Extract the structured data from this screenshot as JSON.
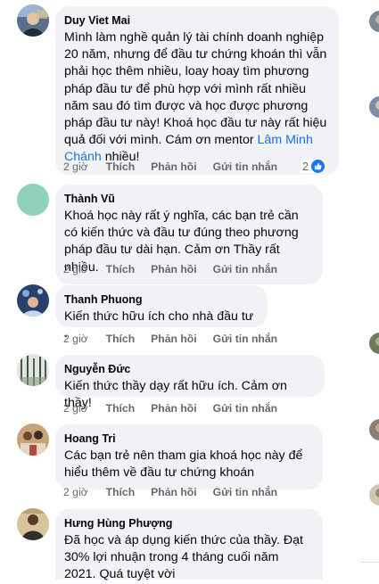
{
  "comments": [
    {
      "author": "Duy Viet Mai",
      "text_before": "Mình làm nghề quản lý tài chính doanh nghiệp 20 năm, nhưng để đầu tư chứng khoán thì vẫn phải học thêm nhiều, loay hoay tìm phương pháp đầu tư để phù hợp với mình rất nhiều năm sau đó tìm được và học được phương pháp đầu tư này! Khoá học đầu tư này rất hiệu quả đối với mình. Cám ơn mentor ",
      "mention": "Lâm Minh Chánh",
      "text_after": " nhiều!",
      "time": "2 giờ",
      "like": "Thích",
      "reply": "Phản hồi",
      "message": "Gửi tin nhắn",
      "reaction_count": "2"
    },
    {
      "author": "Thành Vũ",
      "text": "Khoá học này rất ý nghĩa, các bạn trẻ cần có kiến thức và đầu tư đúng theo phương pháp đầu tư dài hạn. Cảm ơn Thầy rất nhiều.",
      "time": "2 giờ",
      "like": "Thích",
      "reply": "Phản hồi",
      "message": "Gửi tin nhắn"
    },
    {
      "author": "Thanh Phuong",
      "text": "Kiến thức hữu ích cho nhà đầu tư .",
      "time": "2 giờ",
      "like": "Thích",
      "reply": "Phản hồi",
      "message": "Gửi tin nhắn"
    },
    {
      "author": "Nguyễn Đức",
      "text": "Kiến thức thầy dạy rất hữu ích. Cảm ơn thầy!",
      "time": "2 giờ",
      "like": "Thích",
      "reply": "Phản hồi",
      "message": "Gửi tin nhắn"
    },
    {
      "author": "Hoang Tri",
      "text": "Các bạn trẻ nên tham gia khoá học này để hiểu thêm về đầu tư chứng khoán",
      "time": "2 giờ",
      "like": "Thích",
      "reply": "Phản hồi",
      "message": "Gửi tin nhắn"
    },
    {
      "author": "Hưng Hùng Phượng",
      "text": "Đã học và áp dụng kiến thức của thầy. Đạt 30% lợi nhuận trong 4 tháng cuối năm 2021. Quá tuyệt vời"
    }
  ],
  "colors": {
    "bubble": "#f0f2f5",
    "mention": "#216fdb",
    "secondary_text": "#65676b",
    "like_blue": "#1877f2"
  }
}
